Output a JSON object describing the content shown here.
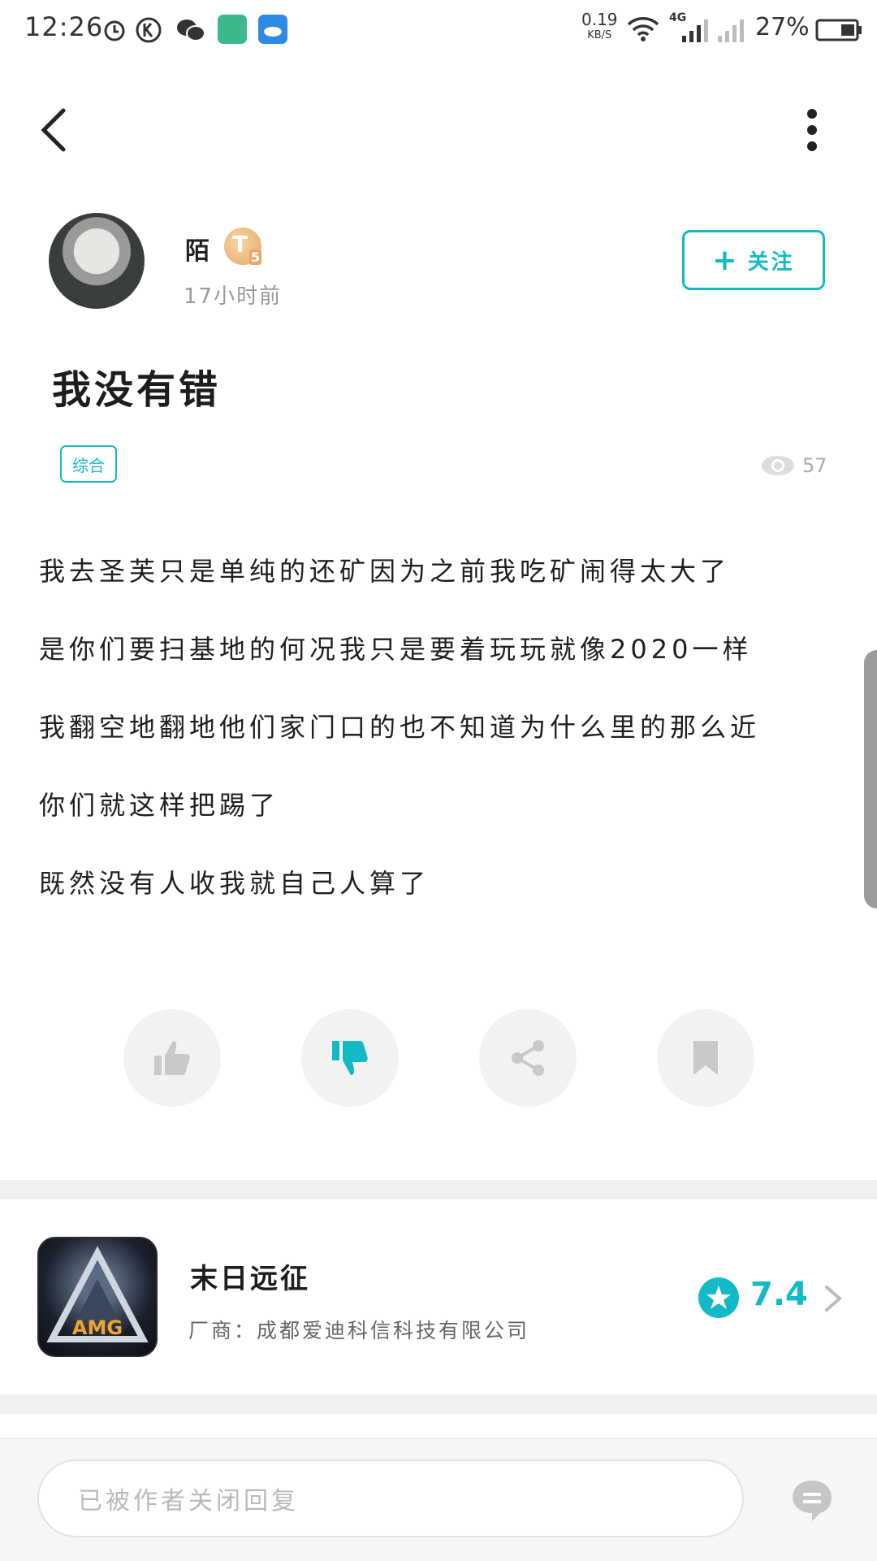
{
  "status_bar": {
    "time": "12:26",
    "net_speed": "0.19",
    "net_unit": "KB/S",
    "network_type": "4G",
    "battery": "27%",
    "icons": [
      "alarm-icon",
      "k-icon",
      "wechat-icon",
      "app-icon",
      "weather-icon",
      "wifi-icon",
      "signal-icon"
    ]
  },
  "author": {
    "name": "陌",
    "level_letter": "T",
    "level_num": "5",
    "time_ago": "17小时前",
    "follow_label": "关注"
  },
  "post": {
    "title": "我没有错",
    "tag": "综合",
    "views": "57",
    "lines": [
      "我去圣芙只是单纯的还矿因为之前我吃矿闹得太大了",
      "是你们要扫基地的何况我只是要着玩玩就像2020一样",
      "我翻空地翻地他们家门口的也不知道为什么里的那么近",
      "你们就这样把踢了",
      "既然没有人收我就自己人算了"
    ]
  },
  "actions": {
    "icons": [
      "thumbs-up-icon",
      "thumbs-down-icon",
      "share-icon",
      "bookmark-icon"
    ]
  },
  "game": {
    "icon_text": "AMG",
    "name": "末日远征",
    "vendor": "厂商：成都爱迪科信科技有限公司",
    "rating": "7.4"
  },
  "reply": {
    "placeholder": "已被作者关闭回复"
  },
  "colors": {
    "accent": "#14b9c8",
    "divider": "#efefef"
  }
}
